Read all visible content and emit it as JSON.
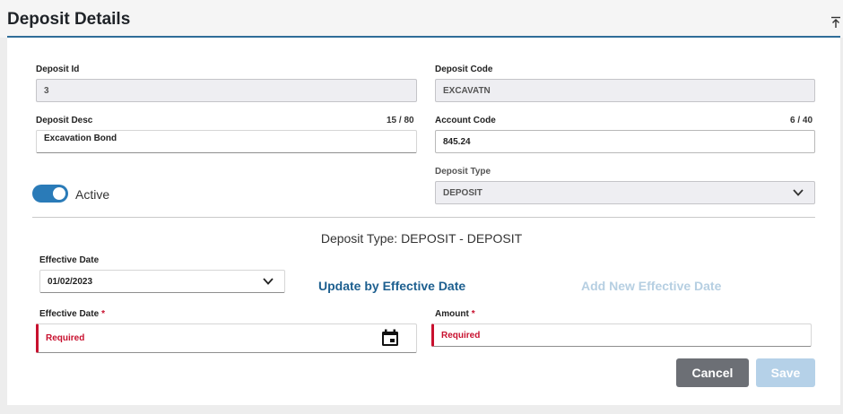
{
  "header": {
    "title": "Deposit Details"
  },
  "form": {
    "deposit_id": {
      "label": "Deposit Id",
      "value": "3"
    },
    "deposit_code": {
      "label": "Deposit Code",
      "value": "EXCAVATN"
    },
    "deposit_desc": {
      "label": "Deposit Desc",
      "counter": "15 / 80",
      "value": "Excavation Bond"
    },
    "account_code": {
      "label": "Account Code",
      "counter": "6 / 40",
      "value": "845.24"
    },
    "deposit_type": {
      "label": "Deposit Type",
      "value": "DEPOSIT"
    },
    "active": {
      "label": "Active",
      "on": true
    }
  },
  "effective": {
    "type_heading": "Deposit Type: DEPOSIT - DEPOSIT",
    "date_select": {
      "label": "Effective Date",
      "value": "01/02/2023"
    },
    "update_link": "Update by Effective Date",
    "add_link": "Add New Effective Date",
    "new_date": {
      "label": "Effective Date",
      "required_mark": "*",
      "error": "Required"
    },
    "amount": {
      "label": "Amount",
      "required_mark": "*",
      "error": "Required"
    }
  },
  "actions": {
    "cancel": "Cancel",
    "save": "Save"
  },
  "colors": {
    "accent": "#2a7bb8",
    "header_rule": "#2f6d98",
    "error": "#c8102e",
    "link": "#1d5f8f",
    "cancel_bg": "#6c6f75",
    "save_disabled_bg": "#b5d1e8"
  },
  "icons": {
    "collapse": "collapse-up-icon",
    "chevron": "chevron-down-icon",
    "calendar": "calendar-icon"
  }
}
